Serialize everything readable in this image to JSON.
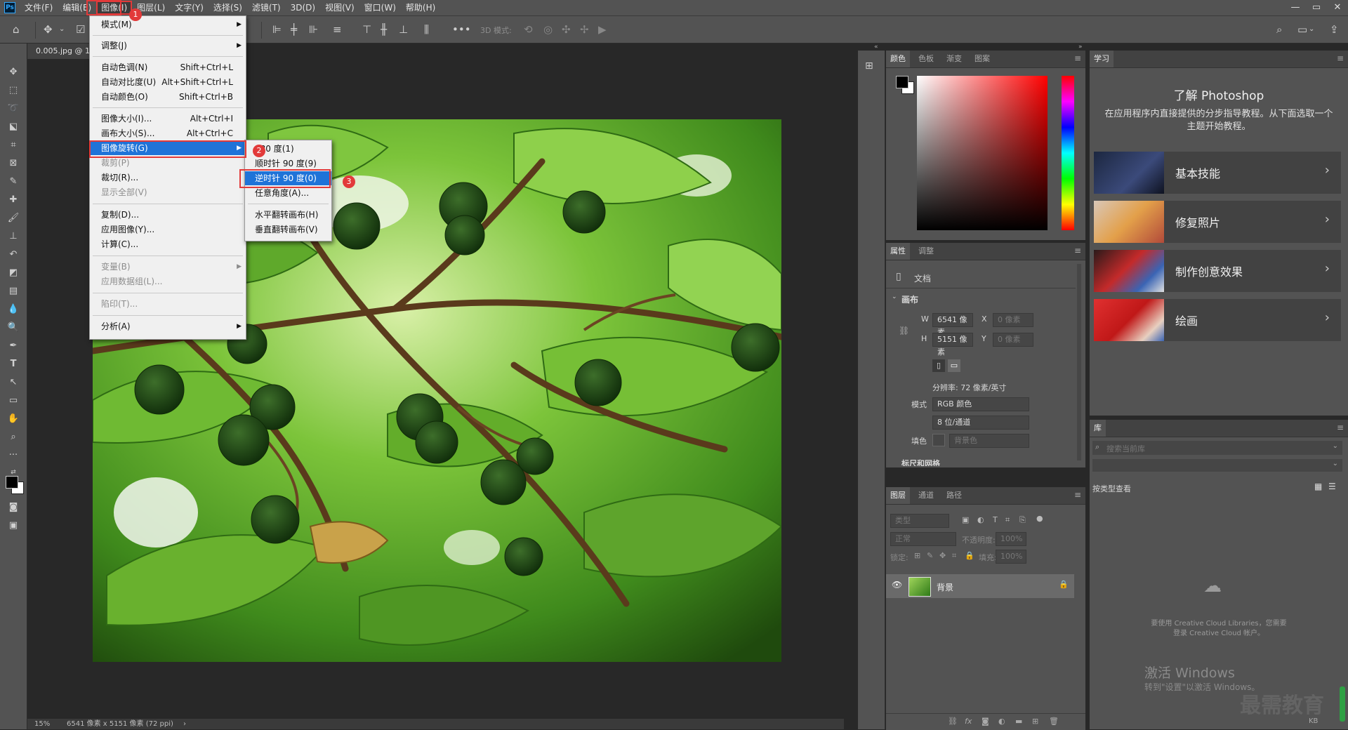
{
  "menubar": {
    "logo": "Ps",
    "items": [
      "文件(F)",
      "编辑(E)",
      "图像(I)",
      "图层(L)",
      "文字(Y)",
      "选择(S)",
      "滤镜(T)",
      "3D(D)",
      "视图(V)",
      "窗口(W)",
      "帮助(H)"
    ],
    "active_index": 2
  },
  "window_controls": [
    "—",
    "▭",
    "✕"
  ],
  "options_bar": {
    "mode_3d_label": "3D 模式:"
  },
  "document": {
    "tab_title": "0.005.jpg @ 15",
    "status_zoom": "15%",
    "status_info": "6541 像素 x 5151 像素 (72 ppi)",
    "status_arrow": "›"
  },
  "image_menu": {
    "items": [
      {
        "label": "模式(M)",
        "shortcut": "",
        "submenu": true,
        "disabled": false
      },
      {
        "label": "调整(J)",
        "shortcut": "",
        "submenu": true,
        "disabled": false
      },
      {
        "label": "自动色调(N)",
        "shortcut": "Shift+Ctrl+L",
        "submenu": false,
        "disabled": false
      },
      {
        "label": "自动对比度(U)",
        "shortcut": "Alt+Shift+Ctrl+L",
        "submenu": false,
        "disabled": false
      },
      {
        "label": "自动颜色(O)",
        "shortcut": "Shift+Ctrl+B",
        "submenu": false,
        "disabled": false
      },
      {
        "label": "图像大小(I)...",
        "shortcut": "Alt+Ctrl+I",
        "submenu": false,
        "disabled": false
      },
      {
        "label": "画布大小(S)...",
        "shortcut": "Alt+Ctrl+C",
        "submenu": false,
        "disabled": false
      },
      {
        "label": "图像旋转(G)",
        "shortcut": "",
        "submenu": true,
        "disabled": false,
        "selected": true
      },
      {
        "label": "裁剪(P)",
        "shortcut": "",
        "submenu": false,
        "disabled": true
      },
      {
        "label": "裁切(R)...",
        "shortcut": "",
        "submenu": false,
        "disabled": false
      },
      {
        "label": "显示全部(V)",
        "shortcut": "",
        "submenu": false,
        "disabled": true
      },
      {
        "label": "复制(D)...",
        "shortcut": "",
        "submenu": false,
        "disabled": false
      },
      {
        "label": "应用图像(Y)...",
        "shortcut": "",
        "submenu": false,
        "disabled": false
      },
      {
        "label": "计算(C)...",
        "shortcut": "",
        "submenu": false,
        "disabled": false
      },
      {
        "label": "变量(B)",
        "shortcut": "",
        "submenu": true,
        "disabled": true
      },
      {
        "label": "应用数据组(L)...",
        "shortcut": "",
        "submenu": false,
        "disabled": true
      },
      {
        "label": "陷印(T)...",
        "shortcut": "",
        "submenu": false,
        "disabled": true
      },
      {
        "label": "分析(A)",
        "shortcut": "",
        "submenu": true,
        "disabled": false
      }
    ]
  },
  "rotate_submenu": {
    "items": [
      {
        "label": "180 度(1)",
        "selected": false
      },
      {
        "label": "顺时针 90 度(9)",
        "selected": false
      },
      {
        "label": "逆时针 90 度(0)",
        "selected": true
      },
      {
        "label": "任意角度(A)...",
        "selected": false
      },
      {
        "label": "水平翻转画布(H)",
        "selected": false
      },
      {
        "label": "垂直翻转画布(V)",
        "selected": false
      }
    ]
  },
  "badges": [
    "1",
    "2",
    "3"
  ],
  "color_panel": {
    "tabs": [
      "颜色",
      "色板",
      "渐变",
      "图案"
    ],
    "fg_color": "#000000",
    "bg_color": "#ffffff",
    "hue_color": "#ff0000"
  },
  "properties_panel": {
    "tabs": [
      "属性",
      "调整"
    ],
    "doc_label": "文档",
    "canvas_section": "画布",
    "w_label": "W",
    "w_value": "6541 像素",
    "h_label": "H",
    "h_value": "5151 像素",
    "x_label": "X",
    "x_value": "0 像素",
    "y_label": "Y",
    "y_value": "0 像素",
    "resolution": "分辨率: 72 像素/英寸",
    "mode_label": "模式",
    "mode_value": "RGB 颜色",
    "depth_value": "8 位/通道",
    "fill_label": "填色",
    "fill_value": "背景色",
    "next_section": "标尺和网格"
  },
  "layers_panel": {
    "tabs": [
      "图层",
      "通道",
      "路径"
    ],
    "filter_placeholder": "类型",
    "blend_mode": "正常",
    "opacity_label": "不透明度:",
    "opacity_value": "100%",
    "lock_label": "锁定:",
    "fill_label": "填充:",
    "fill_value": "100%",
    "layer_name": "背景"
  },
  "learn_panel": {
    "tab": "学习",
    "title": "了解 Photoshop",
    "description": "在应用程序内直接提供的分步指导教程。从下面选取一个主题开始教程。",
    "cards": [
      "基本技能",
      "修复照片",
      "制作创意效果",
      "绘画"
    ]
  },
  "library_panel": {
    "tab": "库",
    "search_placeholder": "搜索当前库",
    "view_label": "按类型查看",
    "signin_message": "要使用 Creative Cloud Libraries，您需要登录 Creative Cloud 帐户。"
  },
  "watermark": {
    "activate_title": "激活 Windows",
    "activate_sub": "转到\"设置\"以激活 Windows。",
    "brand": "最需教育"
  },
  "tray_text": "KB"
}
